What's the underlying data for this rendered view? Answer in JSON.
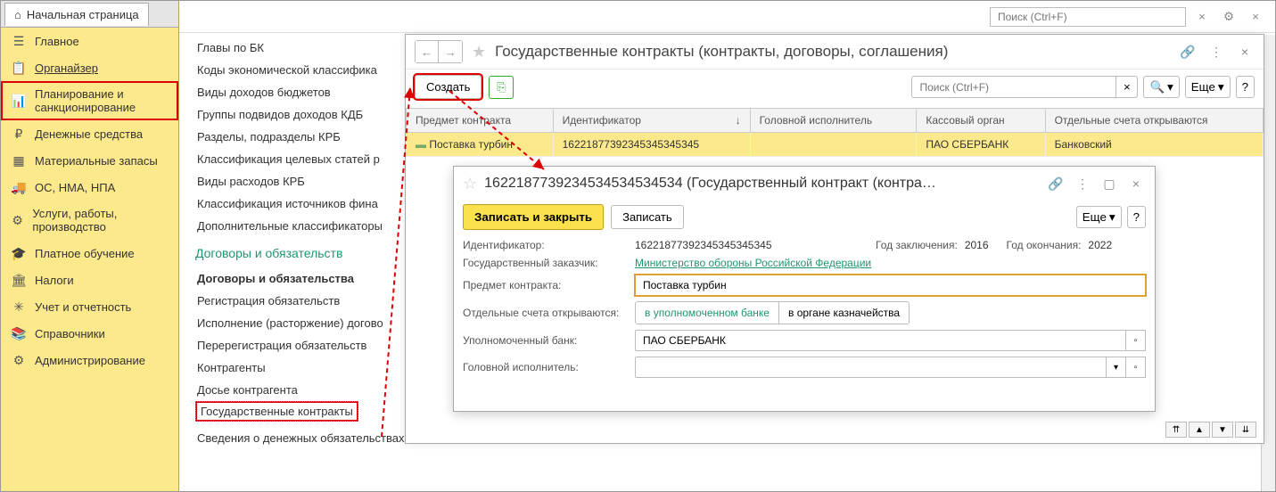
{
  "tab": {
    "title": "Начальная страница"
  },
  "search_top_placeholder": "Поиск (Ctrl+F)",
  "sidebar": {
    "items": [
      {
        "label": "Главное",
        "icon": "☰"
      },
      {
        "label": "Органайзер",
        "icon": "📋",
        "underline": true
      },
      {
        "label": "Планирование и санкционирование",
        "icon": "📊",
        "selected": true
      },
      {
        "label": "Денежные средства",
        "icon": "₽"
      },
      {
        "label": "Материальные запасы",
        "icon": "▦"
      },
      {
        "label": "ОС, НМА, НПА",
        "icon": "🚚"
      },
      {
        "label": "Услуги, работы, производство",
        "icon": "⚙"
      },
      {
        "label": "Платное обучение",
        "icon": "🎓"
      },
      {
        "label": "Налоги",
        "icon": "🏛"
      },
      {
        "label": "Учет и отчетность",
        "icon": "✳"
      },
      {
        "label": "Справочники",
        "icon": "📚"
      },
      {
        "label": "Администрирование",
        "icon": "⚙"
      }
    ]
  },
  "subnav": {
    "block1_title": "Главы по БК",
    "items1": [
      "Коды экономической классифика",
      "Виды доходов бюджетов",
      "Группы подвидов доходов КДБ",
      "Разделы, подразделы КРБ",
      "Классификация целевых статей р",
      "Виды расходов КРБ",
      "Классификация источников фина",
      "Дополнительные классификаторы"
    ],
    "block2_title": "Договоры и обязательств",
    "items2": [
      {
        "label": "Договоры и обязательства",
        "bold": true
      },
      {
        "label": "Регистрация обязательств"
      },
      {
        "label": "Исполнение (расторжение) догово"
      },
      {
        "label": "Перерегистрация обязательств"
      },
      {
        "label": "Контрагенты"
      },
      {
        "label": "Досье контрагента"
      },
      {
        "label": "Государственные контракты",
        "boxed": true
      },
      {
        "label": "Сведения о денежных обязательствах"
      }
    ]
  },
  "list_window": {
    "title": "Государственные контракты (контракты, договоры, соглашения)",
    "create_btn": "Создать",
    "search_placeholder": "Поиск (Ctrl+F)",
    "more_btn": "Еще",
    "columns": [
      "Предмет контракта",
      "Идентификатор",
      "Головной исполнитель",
      "Кассовый орган",
      "Отдельные счета открываются"
    ],
    "row": {
      "subject": "Поставка турбин",
      "id": "16221877392345345345345",
      "executor": "",
      "organ": "ПАО СБЕРБАНК",
      "accounts": "Банковский"
    }
  },
  "detail_window": {
    "title": "1622187739234534534534534 (Государственный контракт (контра…",
    "save_close": "Записать и закрыть",
    "save": "Записать",
    "more": "Еще",
    "fields": {
      "id_label": "Идентификатор:",
      "id_value": "16221877392345345345345",
      "year_start_label": "Год заключения:",
      "year_start": "2016",
      "year_end_label": "Год окончания:",
      "year_end": "2022",
      "customer_label": "Государственный заказчик:",
      "customer_value": "Министерство обороны Российской Федерации",
      "subject_label": "Предмет контракта:",
      "subject_value": "Поставка турбин",
      "accounts_label": "Отдельные счета открываются:",
      "seg1": "в уполномоченном банке",
      "seg2": "в органе казначейства",
      "bank_label": "Уполномоченный банк:",
      "bank_value": "ПАО СБЕРБАНК",
      "executor_label": "Головной исполнитель:",
      "executor_value": ""
    }
  }
}
